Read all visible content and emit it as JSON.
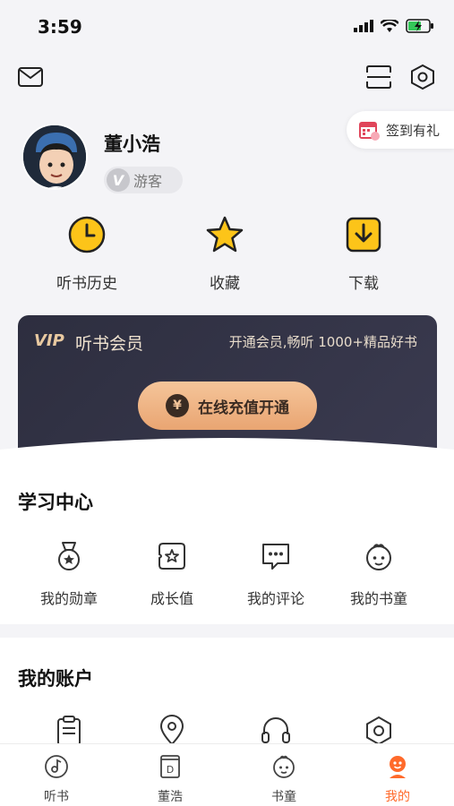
{
  "status_bar": {
    "time": "3:59"
  },
  "checkin": {
    "label": "签到有礼"
  },
  "user": {
    "name": "董小浩",
    "badge_letter": "V",
    "badge_label": "游客"
  },
  "quick_actions": [
    {
      "label": "听书历史",
      "icon": "clock-icon"
    },
    {
      "label": "收藏",
      "icon": "star-icon"
    },
    {
      "label": "下载",
      "icon": "download-icon"
    }
  ],
  "vip": {
    "logo": "VIP",
    "title": "听书会员",
    "subtitle": "开通会员,畅听 1000+精品好书",
    "button_label": "在线充值开通",
    "currency_symbol": "¥"
  },
  "learning": {
    "title": "学习中心",
    "items": [
      {
        "label": "我的勋章",
        "icon": "medal-icon"
      },
      {
        "label": "成长值",
        "icon": "growth-icon"
      },
      {
        "label": "我的评论",
        "icon": "comment-icon"
      },
      {
        "label": "我的书童",
        "icon": "book-kid-icon"
      }
    ]
  },
  "account": {
    "title": "我的账户",
    "items": [
      {
        "icon": "clipboard-icon"
      },
      {
        "icon": "location-icon"
      },
      {
        "icon": "headset-icon"
      },
      {
        "icon": "settings-icon"
      }
    ]
  },
  "tabs": [
    {
      "label": "听书",
      "icon": "music-disc-icon",
      "active": false
    },
    {
      "label": "董浩",
      "icon": "book-d-icon",
      "active": false
    },
    {
      "label": "书童",
      "icon": "kid-face-icon",
      "active": false
    },
    {
      "label": "我的",
      "icon": "profile-icon",
      "active": true
    }
  ],
  "colors": {
    "accent": "#ff6a2b",
    "gold": "#f5c59a",
    "vip_bg": "#2d2e3f",
    "icon_yellow": "#fcc419"
  }
}
